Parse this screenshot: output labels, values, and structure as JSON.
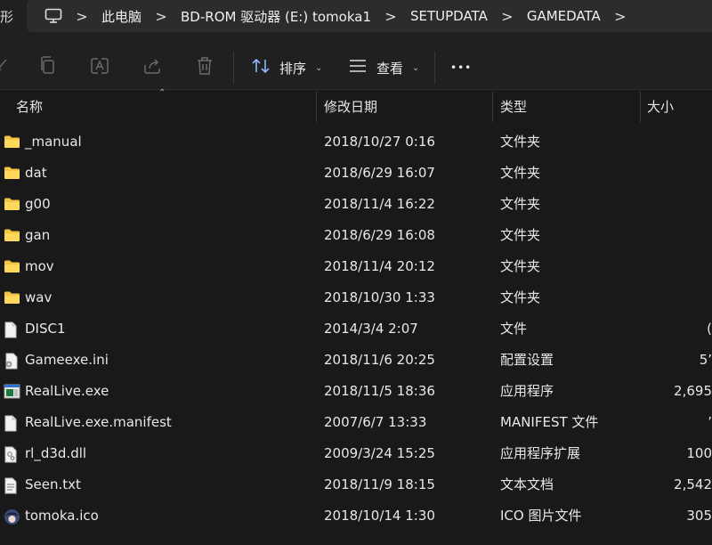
{
  "address": {
    "left_cut": "形",
    "crumbs": [
      "此电脑",
      "BD-ROM 驱动器 (E:) tomoka1",
      "SETUPDATA",
      "GAMEDATA"
    ],
    "separator": ">"
  },
  "toolbar": {
    "sort_label": "排序",
    "view_label": "查看",
    "more_label": "•••"
  },
  "columns": {
    "name": "名称",
    "date": "修改日期",
    "type": "类型",
    "size": "大小"
  },
  "files": [
    {
      "name": "_manual",
      "date": "2018/10/27 0:16",
      "type": "文件夹",
      "size": "",
      "icon": "folder-icon"
    },
    {
      "name": "dat",
      "date": "2018/6/29 16:07",
      "type": "文件夹",
      "size": "",
      "icon": "folder-icon"
    },
    {
      "name": "g00",
      "date": "2018/11/4 16:22",
      "type": "文件夹",
      "size": "",
      "icon": "folder-icon"
    },
    {
      "name": "gan",
      "date": "2018/6/29 16:08",
      "type": "文件夹",
      "size": "",
      "icon": "folder-icon"
    },
    {
      "name": "mov",
      "date": "2018/11/4 20:12",
      "type": "文件夹",
      "size": "",
      "icon": "folder-icon"
    },
    {
      "name": "wav",
      "date": "2018/10/30 1:33",
      "type": "文件夹",
      "size": "",
      "icon": "folder-icon"
    },
    {
      "name": "DISC1",
      "date": "2014/3/4 2:07",
      "type": "文件",
      "size": "(",
      "icon": "file-icon"
    },
    {
      "name": "Gameexe.ini",
      "date": "2018/11/6 20:25",
      "type": "配置设置",
      "size": "5’",
      "icon": "settings-file-icon"
    },
    {
      "name": "RealLive.exe",
      "date": "2018/11/5 18:36",
      "type": "应用程序",
      "size": "2,695",
      "icon": "app-exe-icon"
    },
    {
      "name": "RealLive.exe.manifest",
      "date": "2007/6/7 13:33",
      "type": "MANIFEST 文件",
      "size": "’",
      "icon": "file-icon"
    },
    {
      "name": "rl_d3d.dll",
      "date": "2009/3/24 15:25",
      "type": "应用程序扩展",
      "size": "100",
      "icon": "dll-file-icon"
    },
    {
      "name": "Seen.txt",
      "date": "2018/11/9 18:15",
      "type": "文本文档",
      "size": "2,542",
      "icon": "text-file-icon"
    },
    {
      "name": "tomoka.ico",
      "date": "2018/10/14 1:30",
      "type": "ICO 图片文件",
      "size": "305",
      "icon": "image-ico-icon"
    }
  ],
  "colors": {
    "background": "#191919",
    "toolbar": "#202020",
    "folder": "#f4c542",
    "text": "#e8e8e8"
  }
}
